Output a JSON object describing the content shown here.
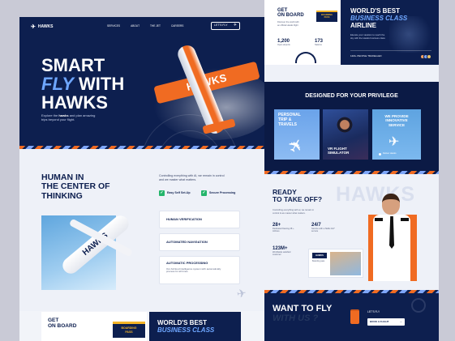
{
  "hero": {
    "logo": "HAWKS",
    "nav": [
      "SERVICES",
      "ABOUT",
      "THE JET",
      "CAREERS"
    ],
    "cta": "LET'S FLY",
    "title_1": "SMART",
    "title_fly": "FLY",
    "title_with": "WITH",
    "title_3": "HAWKS",
    "desc_1": "Explore the",
    "desc_brand": "hawks",
    "desc_2": "and plan amazing",
    "desc_3": "trips beyond your flight.",
    "plane_text": "HAWKS"
  },
  "thinking": {
    "title_1": "HUMAN IN",
    "title_2": "THE CENTER OF",
    "title_3": "THINKING",
    "desc_1": "Controlling everything with AI, we remain in control",
    "desc_2": "and we master what matters.",
    "features": [
      "Easy Self Set-Up",
      "Secure Processing"
    ],
    "items": [
      "HUMAN VERIFICATION",
      "AUTOMATED NAVIGATION",
      "AUTOMATIC PROCESSING"
    ],
    "item_desc_1": "Our AI/cloud intelligence system with automatically",
    "item_desc_2": "process for all times",
    "plane_text": "HAWKS"
  },
  "bottom_left": {
    "get": "GET",
    "on_board": "ON BOARD",
    "sign_1": "BOARDING",
    "sign_2": "PASS",
    "best_1": "WORLD'S BEST",
    "best_2": "BUSINESS CLASS"
  },
  "right_top": {
    "get": "GET",
    "on_board": "ON BOARD",
    "sign_1": "BOARDING",
    "sign_2": "PASS",
    "desc_1": "Discover the world with",
    "desc_2": "an official Hawks flight",
    "stat_1_value": "1,200",
    "stat_1_label": "Open airports",
    "stat_2_value": "173",
    "stat_2_label": "Nations",
    "best_1": "WORLD'S BEST",
    "best_2": "BUSINESS CLASS",
    "best_3": "AIRLINE",
    "best_desc_1": "Elevate your vacation to reach the",
    "best_desc_2": "sky with the Hawks business class",
    "travellers": "12M+ PEOPLE TRAVELLED"
  },
  "privilege": {
    "title": "DESIGNED FOR YOUR PRIVILEGE",
    "card_1_1": "PERSONAL",
    "card_1_2": "TRIP &",
    "card_1_3": "TRAVELS",
    "card_2_1": "VR FLIGHT",
    "card_2_2": "SIMULATOR",
    "card_3_1": "WE PROVIDE",
    "card_3_2": "INNOVATIVE",
    "card_3_3": "SERVICE",
    "card_3_small": "Deliver Hawks"
  },
  "takeoff": {
    "title_1": "READY",
    "title_2": "TO TAKE OFF?",
    "desc_1": "Controlling everything with ai, we remain in",
    "desc_2": "control & we master what matters.",
    "watermark": "HAWKS",
    "stat_1_value": "28+",
    "stat_1_l1": "Dedicated fleeting 28 +",
    "stat_1_l2": "Airlines",
    "stat_2_value": "24/7",
    "stat_2_l1": "Service with a Skills 24/7",
    "stat_2_l2": "service",
    "stat_3_value": "123M+",
    "stat_3_l1": "Worldwide satisfied",
    "stat_3_l2": "customer",
    "mini_logo": "HAWKS",
    "mini_text": "Boarding pass"
  },
  "want": {
    "title_1": "WANT TO FLY",
    "title_2": "WITH US ?",
    "label": "LET'S FLY",
    "button": "BOOK A FLIGHT"
  }
}
